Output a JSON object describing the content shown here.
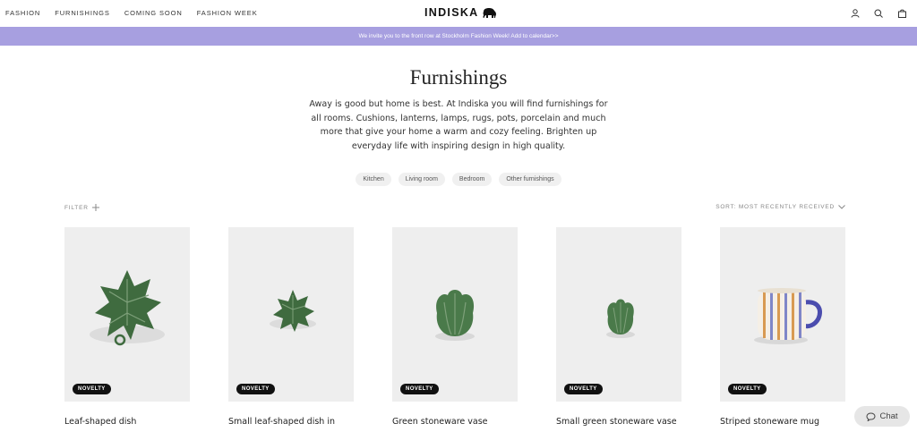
{
  "header": {
    "nav": [
      "FASHION",
      "FURNISHINGS",
      "COMING SOON",
      "FASHION WEEK"
    ],
    "logo_text": "INDISKA",
    "icons": [
      "account-icon",
      "search-icon",
      "bag-icon"
    ]
  },
  "announcement": {
    "text": "We invite you to the front row at Stockholm Fashion Week! Add to calendar>>",
    "background": "#a79fe0"
  },
  "intro": {
    "title": "Furnishings",
    "description": "Away is good but home is best. At Indiska you will find furnishings for all rooms. Cushions, lanterns, lamps, rugs, pots, porcelain and much more that give your home a warm and cozy feeling. Brighten up everyday life with inspiring design in high quality."
  },
  "categories": [
    "Kitchen",
    "Living room",
    "Bedroom",
    "Other furnishings"
  ],
  "toolbar": {
    "filter_label": "FILTER",
    "sort_label": "SORT: MOST RECENTLY RECEIVED"
  },
  "products": [
    {
      "name": "Leaf-shaped dish",
      "badge": "NOVELTY",
      "image": "large green leaf dish"
    },
    {
      "name": "Small leaf-shaped dish in",
      "badge": "NOVELTY",
      "image": "small green leaf dish"
    },
    {
      "name": "Green stoneware vase",
      "badge": "NOVELTY",
      "image": "green cabbage leaf vase"
    },
    {
      "name": "Small green stoneware vase",
      "badge": "NOVELTY",
      "image": "small green cabbage leaf vase"
    },
    {
      "name": "Striped stoneware mug",
      "badge": "NOVELTY",
      "image": "striped mug with blue handle"
    }
  ],
  "chat": {
    "label": "Chat"
  }
}
